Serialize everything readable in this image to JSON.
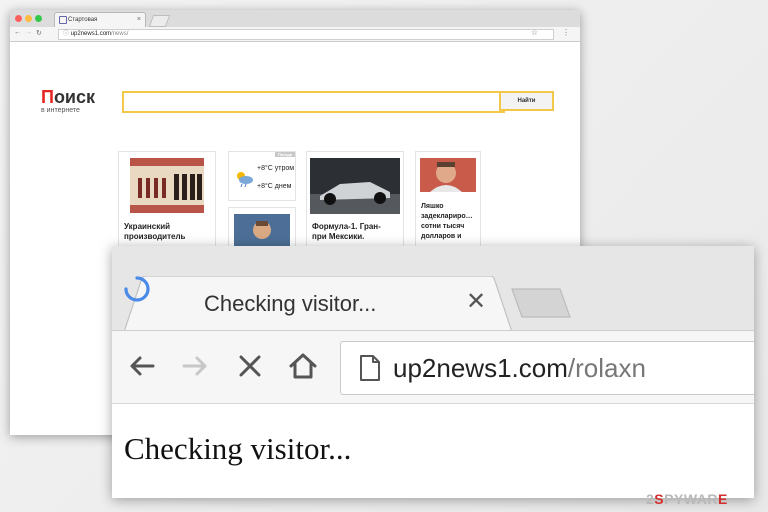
{
  "back_window": {
    "tab_title": "Стартовая",
    "address": {
      "host": "up2news1.com",
      "path": "/news/"
    },
    "logo": {
      "title_first": "П",
      "title_rest": "оиск",
      "subtitle": "в интернете"
    },
    "search": {
      "value": "",
      "button_label": "Найти"
    },
    "cards": [
      {
        "caption_line1": "Украинский",
        "caption_line2": "производитель"
      },
      {
        "badge": "Погода",
        "temp_morning": "+8°С утром",
        "temp_day": "+8°С днем"
      },
      {
        "caption_line1": "Формула-1. Гран-",
        "caption_line2": "при Мексики."
      },
      {
        "caption_line1": "Ляшко",
        "caption_line2": "задеклариро…",
        "caption_line3": "сотни тысяч",
        "caption_line4": "долларов и"
      }
    ]
  },
  "front_window": {
    "tab_title": "Checking visitor...",
    "address": {
      "host": "up2news1.com",
      "path": "/rolaxn"
    },
    "page_text": "Checking visitor..."
  },
  "watermark": {
    "prefix": "2",
    "accent": "S",
    "rest": "PYWAR",
    "suffix": "E"
  },
  "colors": {
    "search_border": "#f2c74a",
    "logo_accent": "#e52520",
    "spinner": "#4a8ae8",
    "watermark_accent": "#d32f2f"
  },
  "icons": [
    "back-arrow-icon",
    "forward-arrow-icon",
    "stop-icon",
    "home-icon",
    "document-icon",
    "spinner-icon",
    "close-icon",
    "star-icon",
    "menu-icon",
    "weather-icon"
  ]
}
